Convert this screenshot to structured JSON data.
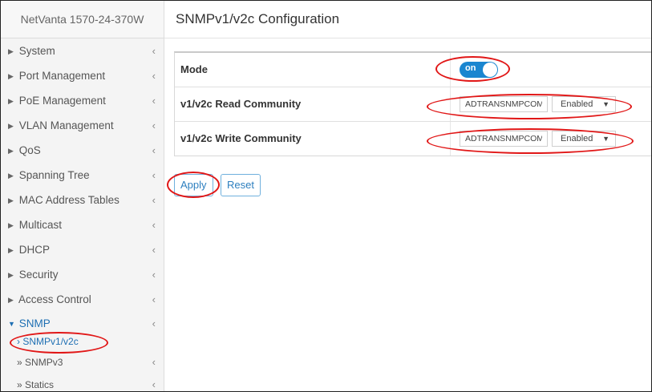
{
  "sidebar": {
    "brand": "NetVanta 1570-24-370W",
    "items": [
      {
        "label": "System"
      },
      {
        "label": "Port Management"
      },
      {
        "label": "PoE Management"
      },
      {
        "label": "VLAN Management"
      },
      {
        "label": "QoS"
      },
      {
        "label": "Spanning Tree"
      },
      {
        "label": "MAC Address Tables"
      },
      {
        "label": "Multicast"
      },
      {
        "label": "DHCP"
      },
      {
        "label": "Security"
      },
      {
        "label": "Access Control"
      },
      {
        "label": "SNMP"
      }
    ],
    "subitems": [
      {
        "label": "SNMPv1/v2c"
      },
      {
        "label": "SNMPv3"
      },
      {
        "label": "Statics"
      }
    ]
  },
  "main": {
    "title": "SNMPv1/v2c Configuration",
    "rows": [
      {
        "label": "Mode",
        "toggle_text": "on"
      },
      {
        "label": "v1/v2c Read Community",
        "value": "ADTRANSNMPCOMI",
        "select": "Enabled"
      },
      {
        "label": "v1/v2c Write Community",
        "value": "ADTRANSNMPCOMI",
        "select": "Enabled"
      }
    ],
    "apply_label": "Apply",
    "reset_label": "Reset"
  },
  "colors": {
    "accent": "#1a86d0",
    "annotation": "#e11717",
    "active_link": "#1e6fb3"
  }
}
